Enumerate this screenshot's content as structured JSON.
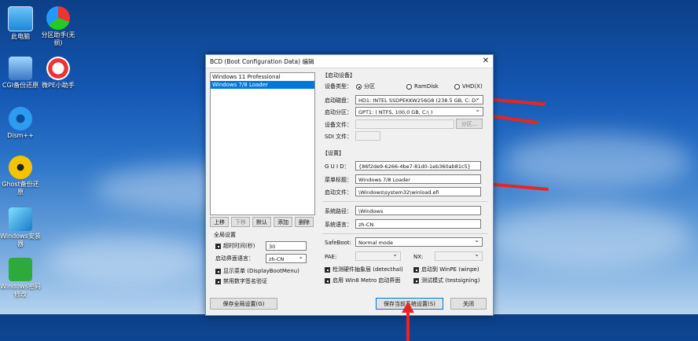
{
  "desktop": {
    "icons": [
      {
        "label": "此电脑",
        "icon": "computer-icon"
      },
      {
        "label": "分区助手(无损)",
        "icon": "partition-assistant-icon"
      },
      {
        "label": "CGI备份还原",
        "icon": "cgi-backup-icon"
      },
      {
        "label": "微PE小助手",
        "icon": "micro-pe-helper-icon"
      },
      {
        "label": "Dism++",
        "icon": "dism-gear-icon"
      },
      {
        "label": "Ghost备份还原",
        "icon": "ghost-icon"
      },
      {
        "label": "Windows安装器",
        "icon": "windows-installer-icon"
      },
      {
        "label": "Windows密码修改",
        "icon": "lock-icon"
      }
    ]
  },
  "window": {
    "title": "BCD (Boot Configuration Data) 编辑",
    "close": "✕",
    "entries": [
      "Windows 11 Professional",
      "Windows 7/8 Loader"
    ],
    "selected_entry": 1,
    "list_buttons": {
      "up": "上移",
      "down": "下移",
      "default": "默认",
      "add": "添加",
      "delete": "删除"
    },
    "global": {
      "title": "全局设置",
      "timeout_label": "超时时间(秒)",
      "timeout_value": "30",
      "lang_label": "启动界面语言：",
      "lang_value": "zh-CN",
      "show_menu": "显示菜单 (DisplayBootMenu)",
      "no_sig": "禁用数字签名验证"
    },
    "boot_device": {
      "title": "【启动设备】",
      "type_label": "设备类型：",
      "type_partition": "分区",
      "type_ramdisk": "RamDisk",
      "type_vhd": "VHD(X)",
      "disk_label": "启动磁盘：",
      "disk_value": "HD1: INTEL SSDPEKKW256G8 (238.5 GB, C: D:",
      "partition_label": "启动分区：",
      "partition_value": "GPT1: ( NTFS, 100.0 GB, C:\\ )",
      "devfile_label": "设备文件：",
      "partition_btn": "分区...",
      "sdi_label": "SDI 文件："
    },
    "settings": {
      "title": "【设置】",
      "guid_label": "G U I D：",
      "guid_value": "{86f2de9-6266-4be7-81d0-1eb360ab81c5}",
      "menu_title_label": "菜单标题：",
      "menu_title_value": "Windows 7/8 Loader",
      "boot_file_label": "启动文件：",
      "boot_file_value": "\\Windows\\system32\\winload.efi",
      "sys_path_label": "系统路径：",
      "sys_path_value": "\\Windows",
      "sys_lang_label": "系统语言：",
      "sys_lang_value": "zh-CN",
      "safeboot_label": "SafeBoot:",
      "safeboot_value": "Normal mode",
      "pae_label": "PAE:",
      "nx_label": "NX:",
      "detect_hal": "检测硬件抽象层 (detecthal)",
      "winpe": "启动到 WinPE (winpe)",
      "metro": "启用 Win8 Metro 启动界面",
      "testsigning": "测试模式 (testsigning)"
    },
    "footer": {
      "save_global": "保存全局设置(G)",
      "save_current": "保存当前系统设置(S)",
      "close": "关闭"
    }
  }
}
